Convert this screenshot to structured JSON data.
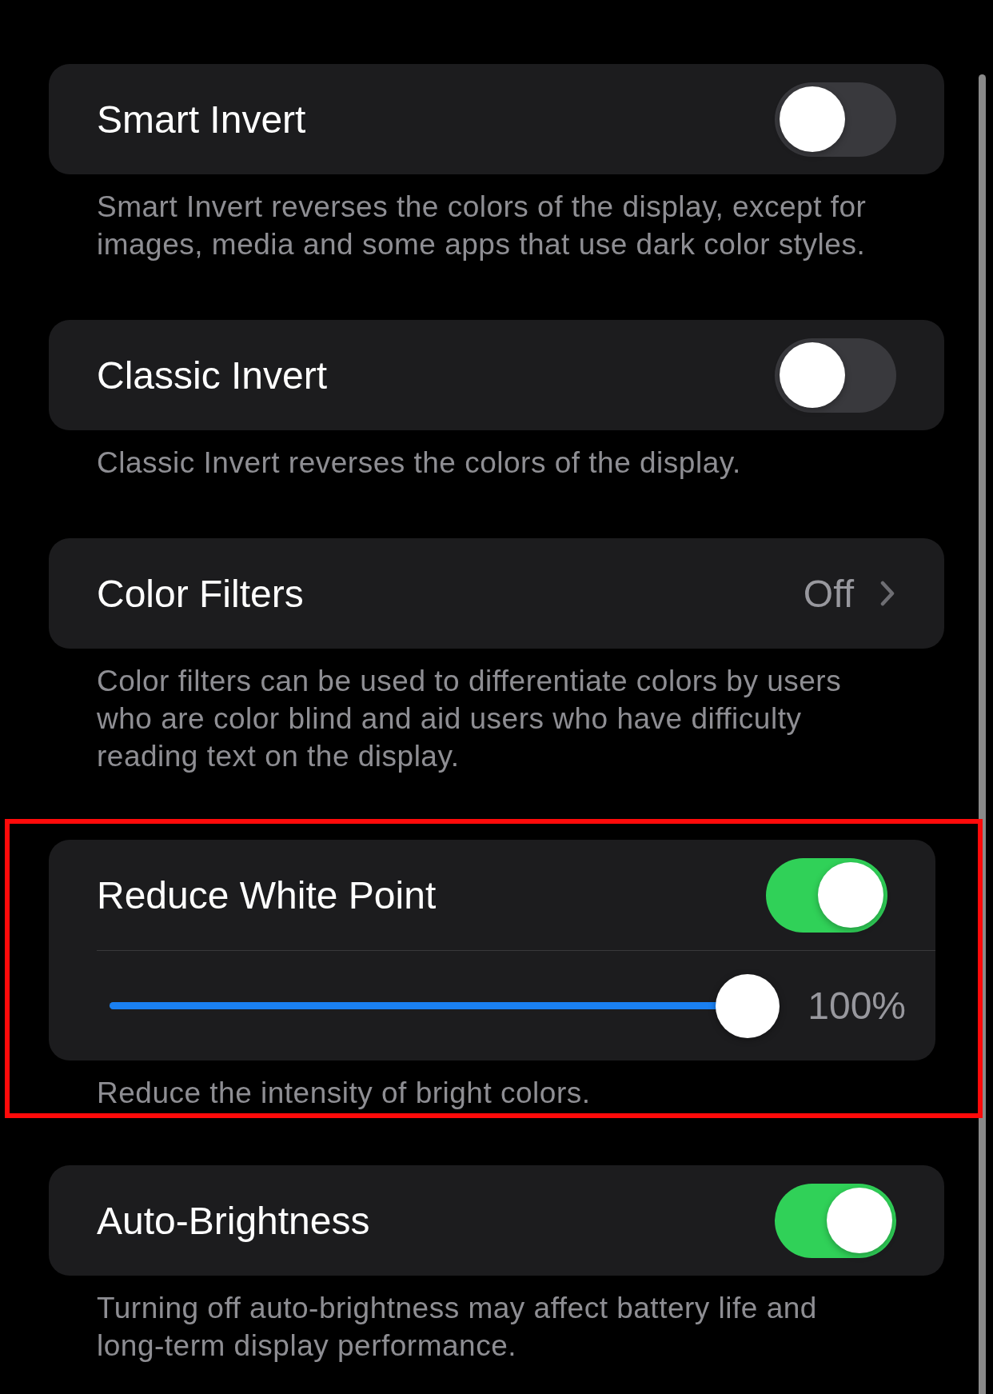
{
  "sections": [
    {
      "kind": "toggle",
      "label": "Smart Invert",
      "on": false,
      "highlighted": false,
      "description": "Smart Invert reverses the colors of the display, except for images, media and some apps that use dark color styles."
    },
    {
      "kind": "toggle",
      "label": "Classic Invert",
      "on": false,
      "highlighted": false,
      "description": "Classic Invert reverses the colors of the display."
    },
    {
      "kind": "link",
      "label": "Color Filters",
      "value": "Off",
      "highlighted": false,
      "description": "Color filters can be used to differentiate colors by users who are color blind and aid users who have difficulty reading text on the display."
    },
    {
      "kind": "toggle_slider",
      "label": "Reduce White Point",
      "on": true,
      "slider": {
        "level": 1.0,
        "reading": "100%"
      },
      "highlighted": true,
      "description": "Reduce the intensity of bright colors."
    },
    {
      "kind": "toggle",
      "label": "Auto-Brightness",
      "on": true,
      "highlighted": false,
      "description": "Turning off auto-brightness may affect battery life and long-term display performance."
    }
  ]
}
